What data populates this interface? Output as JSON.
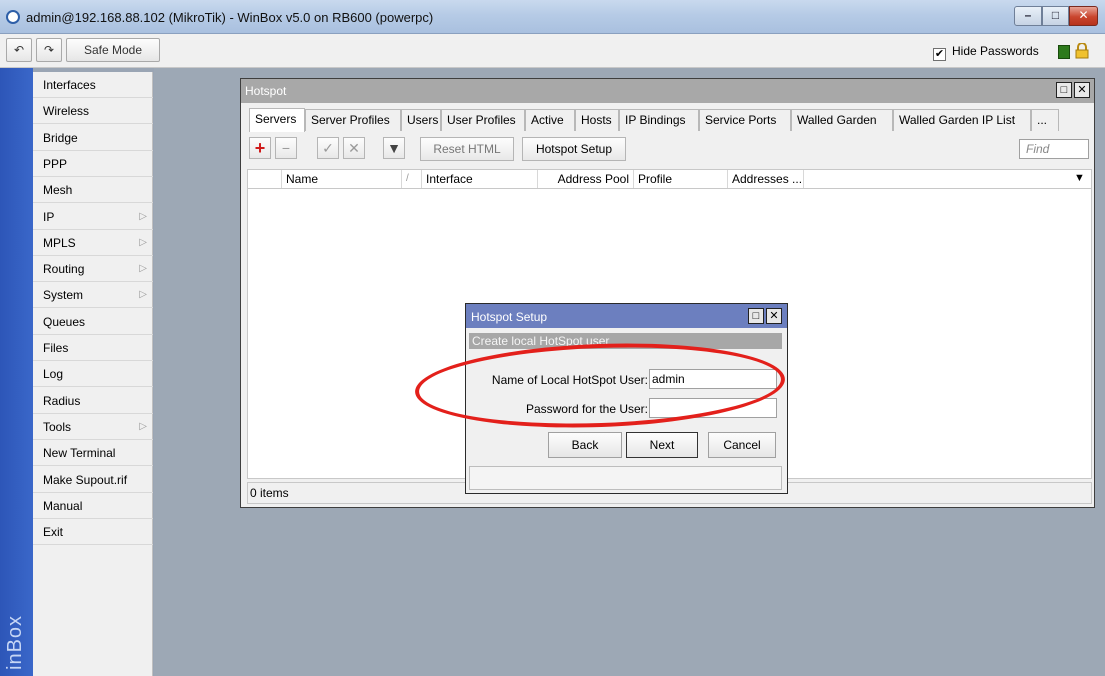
{
  "window": {
    "title": "admin@192.168.88.102 (MikroTik) - WinBox v5.0 on RB600 (powerpc)",
    "controls": {
      "minimize": "–",
      "maximize": "□",
      "close": "✕"
    }
  },
  "toolbar": {
    "undo": "↶",
    "redo": "↷",
    "safe_mode": "Safe Mode",
    "hide_passwords_label": "Hide Passwords",
    "hide_passwords_checked": "✔"
  },
  "brand": "inBox",
  "menu": [
    {
      "label": "Interfaces",
      "arrow": ""
    },
    {
      "label": "Wireless",
      "arrow": ""
    },
    {
      "label": "Bridge",
      "arrow": ""
    },
    {
      "label": "PPP",
      "arrow": ""
    },
    {
      "label": "Mesh",
      "arrow": ""
    },
    {
      "label": "IP",
      "arrow": "▷"
    },
    {
      "label": "MPLS",
      "arrow": "▷"
    },
    {
      "label": "Routing",
      "arrow": "▷"
    },
    {
      "label": "System",
      "arrow": "▷"
    },
    {
      "label": "Queues",
      "arrow": ""
    },
    {
      "label": "Files",
      "arrow": ""
    },
    {
      "label": "Log",
      "arrow": ""
    },
    {
      "label": "Radius",
      "arrow": ""
    },
    {
      "label": "Tools",
      "arrow": "▷"
    },
    {
      "label": "New Terminal",
      "arrow": ""
    },
    {
      "label": "Make Supout.rif",
      "arrow": ""
    },
    {
      "label": "Manual",
      "arrow": ""
    },
    {
      "label": "Exit",
      "arrow": ""
    }
  ],
  "hotspot": {
    "title": "Hotspot",
    "tabs": [
      "Servers",
      "Server Profiles",
      "Users",
      "User Profiles",
      "Active",
      "Hosts",
      "IP Bindings",
      "Service Ports",
      "Walled Garden",
      "Walled Garden IP List",
      "..."
    ],
    "active_tab": "Servers",
    "tools": {
      "add": "+",
      "remove": "−",
      "enable": "✓",
      "disable": "✕",
      "filter": "▼",
      "reset_html": "Reset HTML",
      "hotspot_setup": "Hotspot Setup"
    },
    "find_placeholder": "Find",
    "columns": [
      "Name",
      "/",
      "Interface",
      "Address Pool",
      "Profile",
      "Addresses ..."
    ],
    "status": "0 items"
  },
  "setup_dialog": {
    "title": "Hotspot Setup",
    "subtitle": "Create local HotSpot user",
    "user_label": "Name of Local HotSpot User:",
    "user_value": "admin",
    "password_label": "Password for the User:",
    "password_value": "",
    "back": "Back",
    "next": "Next",
    "cancel": "Cancel"
  },
  "colors": {
    "annotation": "#e3201b",
    "brand_strip": "#2d56b8",
    "dialog_title": "#6c7fbf"
  }
}
